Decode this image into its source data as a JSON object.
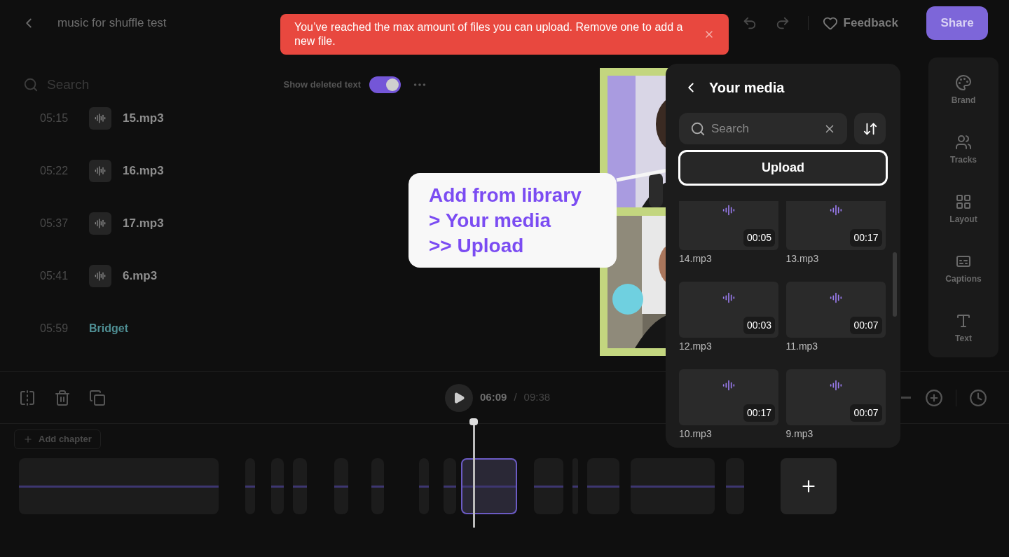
{
  "header": {
    "title": "music for shuffle test",
    "feedback": "Feedback",
    "share": "Share"
  },
  "toast": {
    "message": "You’ve reached the max amount of files you can upload. Remove one to add a new file."
  },
  "transcript": {
    "search_placeholder": "Search",
    "toggle_label": "Show deleted text",
    "toggle_on": true,
    "rows": [
      {
        "time": "05:15",
        "kind": "audio",
        "label": "15.mp3"
      },
      {
        "time": "05:22",
        "kind": "audio",
        "label": "16.mp3"
      },
      {
        "time": "05:37",
        "kind": "audio",
        "label": "17.mp3"
      },
      {
        "time": "05:41",
        "kind": "audio",
        "label": "6.mp3"
      },
      {
        "time": "05:59",
        "kind": "speaker",
        "label": "Bridget"
      }
    ]
  },
  "tool_rail": [
    {
      "kind": "brand",
      "label": "Brand"
    },
    {
      "kind": "tracks",
      "label": "Tracks"
    },
    {
      "kind": "layout",
      "label": "Layout"
    },
    {
      "kind": "captions",
      "label": "Captions"
    },
    {
      "kind": "text",
      "label": "Text"
    }
  ],
  "player": {
    "current": "06:09",
    "separator": "/",
    "total": "09:38"
  },
  "timeline": {
    "add_chapter": "Add chapter",
    "clips": [
      {
        "selected": false
      },
      {
        "selected": false
      },
      {
        "selected": false
      },
      {
        "selected": false
      },
      {
        "selected": false
      },
      {
        "selected": false
      },
      {
        "selected": false
      },
      {
        "selected": false
      },
      {
        "selected": true
      },
      {
        "selected": false
      },
      {
        "selected": false
      },
      {
        "selected": false
      },
      {
        "selected": false
      },
      {
        "selected": false
      }
    ]
  },
  "media_panel": {
    "title": "Your media",
    "search_placeholder": "Search",
    "upload": "Upload",
    "items": [
      {
        "name": "14.mp3",
        "duration": "00:05"
      },
      {
        "name": "13.mp3",
        "duration": "00:17"
      },
      {
        "name": "12.mp3",
        "duration": "00:03"
      },
      {
        "name": "11.mp3",
        "duration": "00:07"
      },
      {
        "name": "10.mp3",
        "duration": "00:17"
      },
      {
        "name": "9.mp3",
        "duration": "00:07"
      }
    ]
  },
  "callout": {
    "lines": [
      "Add from library",
      "> Your media",
      ">> Upload"
    ]
  }
}
